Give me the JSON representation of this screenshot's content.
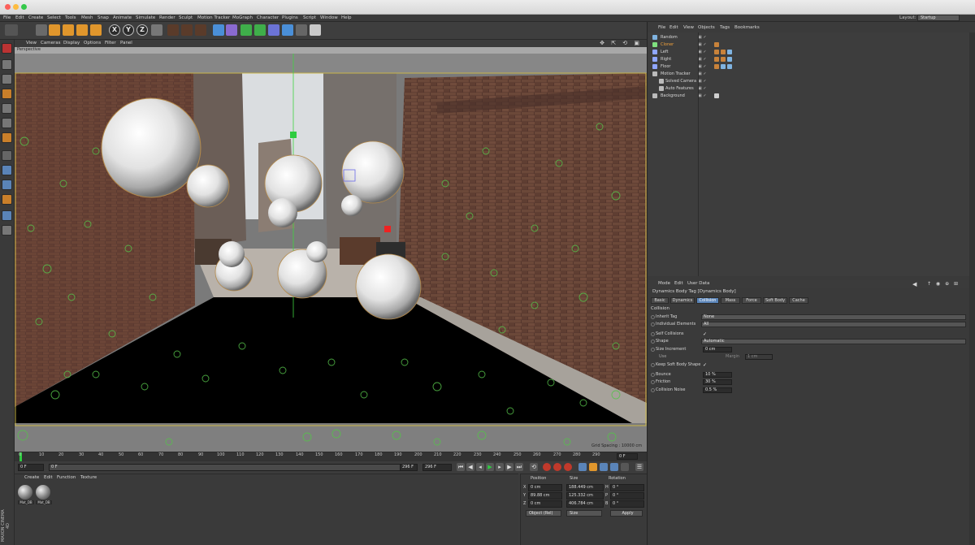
{
  "menubar": {
    "items": [
      "File",
      "Edit",
      "Create",
      "Select",
      "Tools",
      "Mesh",
      "Snap",
      "Animate",
      "Simulate",
      "Render",
      "Sculpt",
      "Motion Tracker",
      "MoGraph",
      "Character",
      "Plugins",
      "Script",
      "Window",
      "Help"
    ],
    "layout_label": "Layout:",
    "layout_value": "Startup"
  },
  "toolbar": {
    "axis_x": "X",
    "axis_y": "Y",
    "axis_z": "Z"
  },
  "viewport": {
    "menu": [
      "View",
      "Cameras",
      "Display",
      "Options",
      "Filter",
      "Panel"
    ],
    "label": "Perspective",
    "grid_spacing": "Grid Spacing : 10000 cm"
  },
  "timeline": {
    "ticks": [
      "0",
      "10",
      "20",
      "30",
      "40",
      "50",
      "60",
      "70",
      "80",
      "90",
      "100",
      "110",
      "120",
      "130",
      "140",
      "150",
      "160",
      "170",
      "180",
      "190",
      "200",
      "210",
      "220",
      "230",
      "240",
      "250",
      "260",
      "270",
      "280",
      "290"
    ],
    "current_frame": "0 F",
    "start_field": "0 F",
    "min_field": "0 F",
    "end_field": "296 F",
    "max_field": "296 F"
  },
  "materials": {
    "menu": [
      "Create",
      "Edit",
      "Function",
      "Texture"
    ],
    "items": [
      {
        "name": "Mat_DB"
      },
      {
        "name": "Mat_DB"
      }
    ],
    "logo": "MAXON CINEMA 4D"
  },
  "coordinates": {
    "headers": [
      "Position",
      "Size",
      "Rotation"
    ],
    "rows": [
      {
        "axis": "X",
        "pos": "0 cm",
        "size": "188.449 cm",
        "rot_axis": "H",
        "rot": "0 °"
      },
      {
        "axis": "Y",
        "pos": "89.88 cm",
        "size": "125.332 cm",
        "rot_axis": "P",
        "rot": "0 °"
      },
      {
        "axis": "Z",
        "pos": "0 cm",
        "size": "406.784 cm",
        "rot_axis": "B",
        "rot": "0 °"
      }
    ],
    "mode": "Object (Rel)",
    "size_mode": "Size",
    "apply": "Apply"
  },
  "object_manager": {
    "menu": [
      "File",
      "Edit",
      "View",
      "Objects",
      "Tags",
      "Bookmarks"
    ],
    "objects": [
      {
        "name": "Random",
        "icon_color": "#7fb3e0",
        "selected": false,
        "indent": 0
      },
      {
        "name": "Cloner",
        "icon_color": "#7fe07f",
        "selected": true,
        "indent": 0
      },
      {
        "name": "Left",
        "icon_color": "#8fa6ff",
        "selected": false,
        "indent": 0
      },
      {
        "name": "Right",
        "icon_color": "#8fa6ff",
        "selected": false,
        "indent": 0
      },
      {
        "name": "Floor",
        "icon_color": "#8fa6ff",
        "selected": false,
        "indent": 0
      },
      {
        "name": "Motion Tracker",
        "icon_color": "#bbbbbb",
        "selected": false,
        "indent": 0
      },
      {
        "name": "Solved Camera",
        "icon_color": "#bbbbbb",
        "selected": false,
        "indent": 1
      },
      {
        "name": "Auto Features",
        "icon_color": "#bbbbbb",
        "selected": false,
        "indent": 1
      },
      {
        "name": "Background",
        "icon_color": "#bbbbbb",
        "selected": false,
        "indent": 0
      }
    ]
  },
  "attribute_manager": {
    "menu": [
      "Mode",
      "Edit",
      "User Data"
    ],
    "title": "Dynamics Body Tag [Dynamics Body]",
    "tabs": [
      {
        "label": "Basic",
        "active": false
      },
      {
        "label": "Dynamics",
        "active": false
      },
      {
        "label": "Collision",
        "active": true
      },
      {
        "label": "Mass",
        "active": false
      },
      {
        "label": "Force",
        "active": false
      },
      {
        "label": "Soft Body",
        "active": false
      },
      {
        "label": "Cache",
        "active": false
      }
    ],
    "section": "Collision",
    "props": {
      "inherit_tag_label": "Inherit Tag",
      "inherit_tag_value": "None",
      "individual_label": "Individual Elements",
      "individual_value": "All",
      "self_collisions_label": "Self Collisions",
      "self_collisions_value": "✓",
      "shape_label": "Shape",
      "shape_value": "Automatic",
      "size_increment_label": "Size Increment",
      "size_increment_value": "0 cm",
      "use_label": "Use",
      "margin_label": "Margin",
      "margin_value": "1 cm",
      "keep_soft_label": "Keep Soft Body Shape",
      "keep_soft_value": "✓",
      "bounce_label": "Bounce",
      "bounce_value": "10 %",
      "friction_label": "Friction",
      "friction_value": "30 %",
      "noise_label": "Collision Noise",
      "noise_value": "0.5 %"
    }
  },
  "colors": {
    "accent": "#5a84b8",
    "selected_object": "#f2a23c",
    "floor": "#000000",
    "brick": "#5a3a30"
  }
}
